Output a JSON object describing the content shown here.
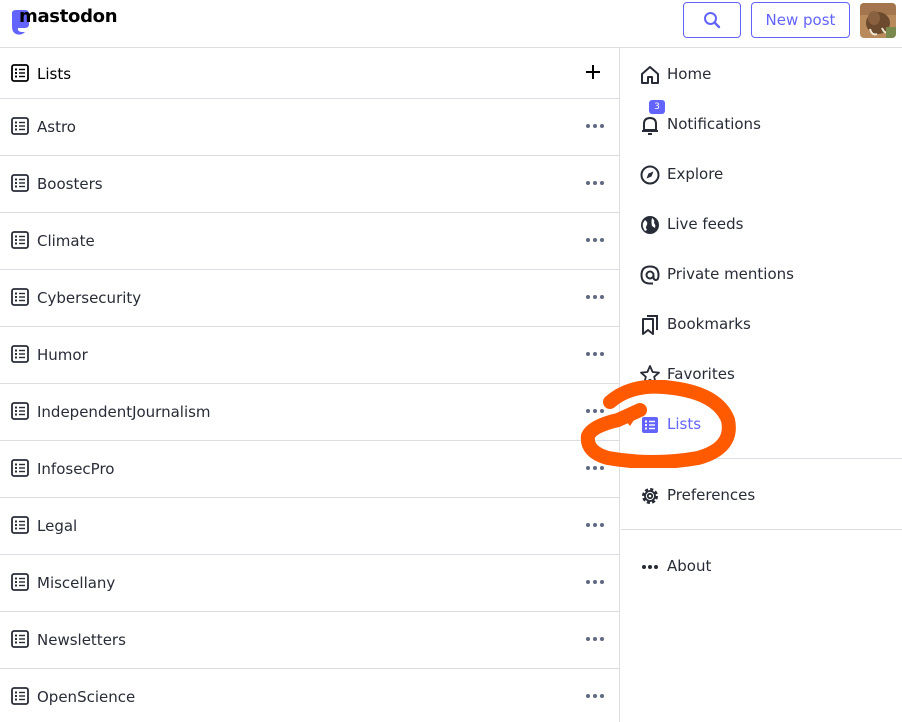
{
  "header": {
    "logo_text": "mastodon",
    "new_post_label": "New post",
    "accent": "#6364ff"
  },
  "lists": {
    "title": "Lists",
    "items": [
      {
        "label": "Astro"
      },
      {
        "label": "Boosters"
      },
      {
        "label": "Climate"
      },
      {
        "label": "Cybersecurity"
      },
      {
        "label": "Humor"
      },
      {
        "label": "IndependentJournalism"
      },
      {
        "label": "InfosecPro"
      },
      {
        "label": "Legal"
      },
      {
        "label": "Miscellany"
      },
      {
        "label": "Newsletters"
      },
      {
        "label": "OpenScience"
      }
    ]
  },
  "nav": {
    "items": [
      {
        "label": "Home",
        "icon": "home-icon"
      },
      {
        "label": "Notifications",
        "icon": "bell-icon",
        "badge": "3"
      },
      {
        "label": "Explore",
        "icon": "compass-icon"
      },
      {
        "label": "Live feeds",
        "icon": "globe-icon"
      },
      {
        "label": "Private mentions",
        "icon": "at-icon"
      },
      {
        "label": "Bookmarks",
        "icon": "bookmarks-icon"
      },
      {
        "label": "Favorites",
        "icon": "star-icon"
      },
      {
        "label": "Lists",
        "icon": "list-icon",
        "active": true
      },
      {
        "label": "Preferences",
        "icon": "gear-icon"
      },
      {
        "label": "About",
        "icon": "ellipsis-icon"
      }
    ],
    "highlight_color": "#ff5a00"
  }
}
